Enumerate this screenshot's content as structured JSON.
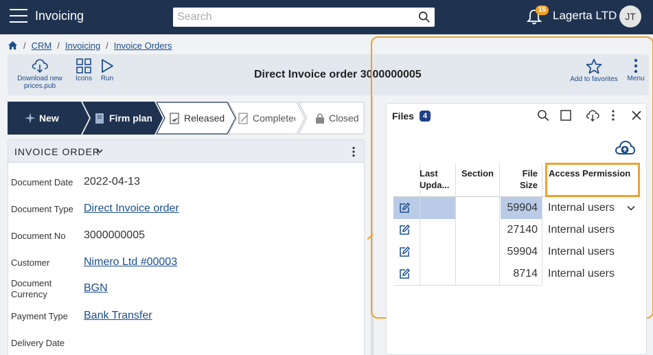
{
  "header": {
    "app_title": "Invoicing",
    "search_placeholder": "Search",
    "notification_count": "15",
    "company": "Lagerta LTD",
    "avatar_initials": "JT"
  },
  "breadcrumb": [
    "CRM",
    "Invoicing",
    "Invoice Orders"
  ],
  "toolbar": {
    "download_label": "Download new prices.pub",
    "icons_label": "Icons",
    "run_label": "Run",
    "title": "Direct Invoice order 3000000005",
    "favorites_label": "Add to favorites",
    "menu_label": "Menu"
  },
  "stages": [
    {
      "label": "New",
      "state": "done"
    },
    {
      "label": "Firm planr",
      "state": "done"
    },
    {
      "label": "Released",
      "state": "current"
    },
    {
      "label": "Completec",
      "state": "pending"
    },
    {
      "label": "Closed",
      "state": "pending"
    }
  ],
  "invoice": {
    "section_title": "INVOICE ORDER",
    "fields": [
      {
        "label": "Document Date",
        "value": "2022-04-13",
        "link": false
      },
      {
        "label": "Document Type",
        "value": "Direct Invoice order",
        "link": true
      },
      {
        "label": "Document No",
        "value": "3000000005",
        "link": false
      },
      {
        "label": "Customer",
        "value": "Nimero Ltd #00003",
        "link": true
      },
      {
        "label": "Document Currency",
        "value": "BGN",
        "link": true
      },
      {
        "label": "Payment Type",
        "value": "Bank Transfer",
        "link": true
      },
      {
        "label": "Delivery Date",
        "value": "",
        "link": false
      }
    ]
  },
  "files": {
    "title": "Files",
    "count": "4",
    "columns": {
      "last_updated": "Last Upda...",
      "section": "Section",
      "file_size": "File Size",
      "access": "Access Permission"
    },
    "rows": [
      {
        "size": "59904",
        "access": "Internal users",
        "selected": true
      },
      {
        "size": "27140",
        "access": "Internal users",
        "selected": false
      },
      {
        "size": "59904",
        "access": "Internal users",
        "selected": false
      },
      {
        "size": "8714",
        "access": "Internal users",
        "selected": false
      }
    ]
  },
  "colors": {
    "topbar": "#1f3350",
    "accent": "#1a4e8c",
    "highlight": "#f0a12a",
    "stage_done": "#1f3350",
    "selected_cell": "#b9cbe6"
  }
}
